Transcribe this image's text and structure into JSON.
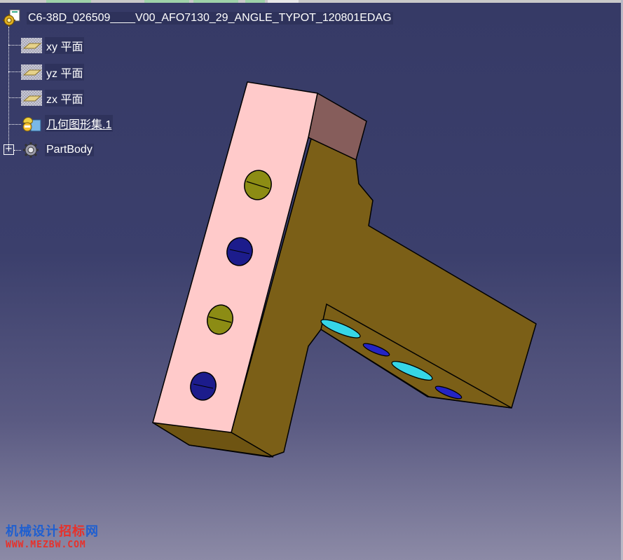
{
  "tree": {
    "root": {
      "label": "C6-38D_026509____V00_AFO7130_29_ANGLE_TYPOT_120801EDAG",
      "icon": "part-document-icon"
    },
    "items": [
      {
        "label": "xy 平面",
        "icon": "plane-icon"
      },
      {
        "label": "yz 平面",
        "icon": "plane-icon"
      },
      {
        "label": "zx 平面",
        "icon": "plane-icon"
      },
      {
        "label": "几何图形集.1",
        "icon": "geometrical-set-icon"
      },
      {
        "label": "PartBody",
        "icon": "part-body-gear-icon",
        "expander": "+"
      }
    ]
  },
  "model": {
    "colors": {
      "pink_face": "#ffcaca",
      "brown_body": "#7b5f17",
      "mauve_face": "#865d5b",
      "olive_hole": "#8c8c14",
      "navy_hole": "#1c1c8c",
      "cyan_slot": "#36d6e6",
      "blue_slot": "#2424c4"
    }
  },
  "watermark": {
    "line1_a": "机械设计",
    "line1_b": "招标",
    "line1_c": "网",
    "line2": "WWW.MEZBW.COM"
  }
}
